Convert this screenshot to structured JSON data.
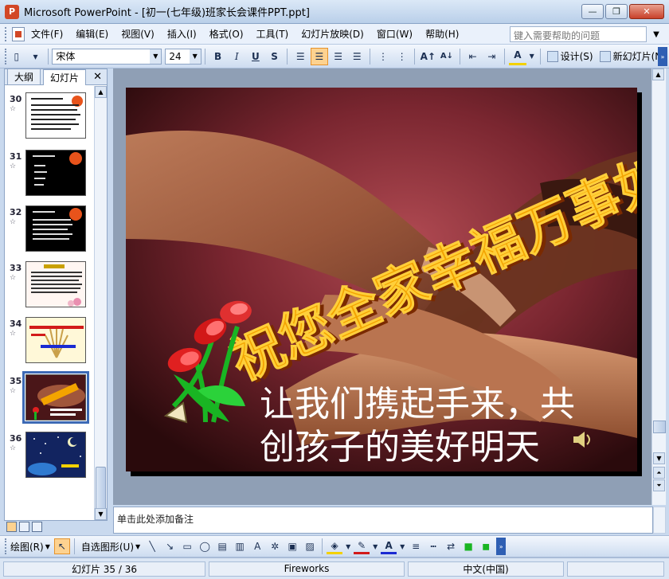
{
  "window": {
    "title": "Microsoft PowerPoint - [初一(七年级)班家长会课件PPT.ppt]",
    "app_badge": "P",
    "minimize_glyph": "—",
    "restore_glyph": "❐",
    "close_glyph": "✕"
  },
  "menu": {
    "items": [
      "文件(F)",
      "编辑(E)",
      "视图(V)",
      "插入(I)",
      "格式(O)",
      "工具(T)",
      "幻灯片放映(D)",
      "窗口(W)",
      "帮助(H)"
    ],
    "help_placeholder": "键入需要帮助的问题"
  },
  "toolbar": {
    "font_name": "宋体",
    "font_size": "24",
    "bold": "B",
    "italic": "I",
    "underline": "U",
    "shadow": "S",
    "design_label": "设计(S)",
    "new_slide_label": "新幻灯片(N)"
  },
  "panel": {
    "tabs": [
      "大纲",
      "幻灯片"
    ],
    "active_tab": "幻灯片",
    "close_glyph": "✕",
    "slides": [
      {
        "num": "30",
        "theme": "dark-list"
      },
      {
        "num": "31",
        "theme": "dark-list"
      },
      {
        "num": "32",
        "theme": "dark-list"
      },
      {
        "num": "33",
        "theme": "light-text"
      },
      {
        "num": "34",
        "theme": "light-yellow"
      },
      {
        "num": "35",
        "theme": "current"
      },
      {
        "num": "36",
        "theme": "night"
      }
    ],
    "selected": "35"
  },
  "slide": {
    "title_art": "祝您全家幸福万事如意",
    "caption_line1": "让我们携起手来，共",
    "caption_line2": "创孩子的美好明天",
    "speaker_icon": "sound-icon"
  },
  "notes": {
    "placeholder": "单击此处添加备注"
  },
  "drawbar": {
    "draw_label": "绘图(R)",
    "autoshape_label": "自选图形(U)"
  },
  "status": {
    "slide_position": "幻灯片 35 / 36",
    "design_name": "Fireworks",
    "language": "中文(中国)"
  },
  "colors": {
    "accent": "#3d6ab5",
    "title_gold": "#f3a400",
    "slide_bg": "#5a1e20"
  }
}
